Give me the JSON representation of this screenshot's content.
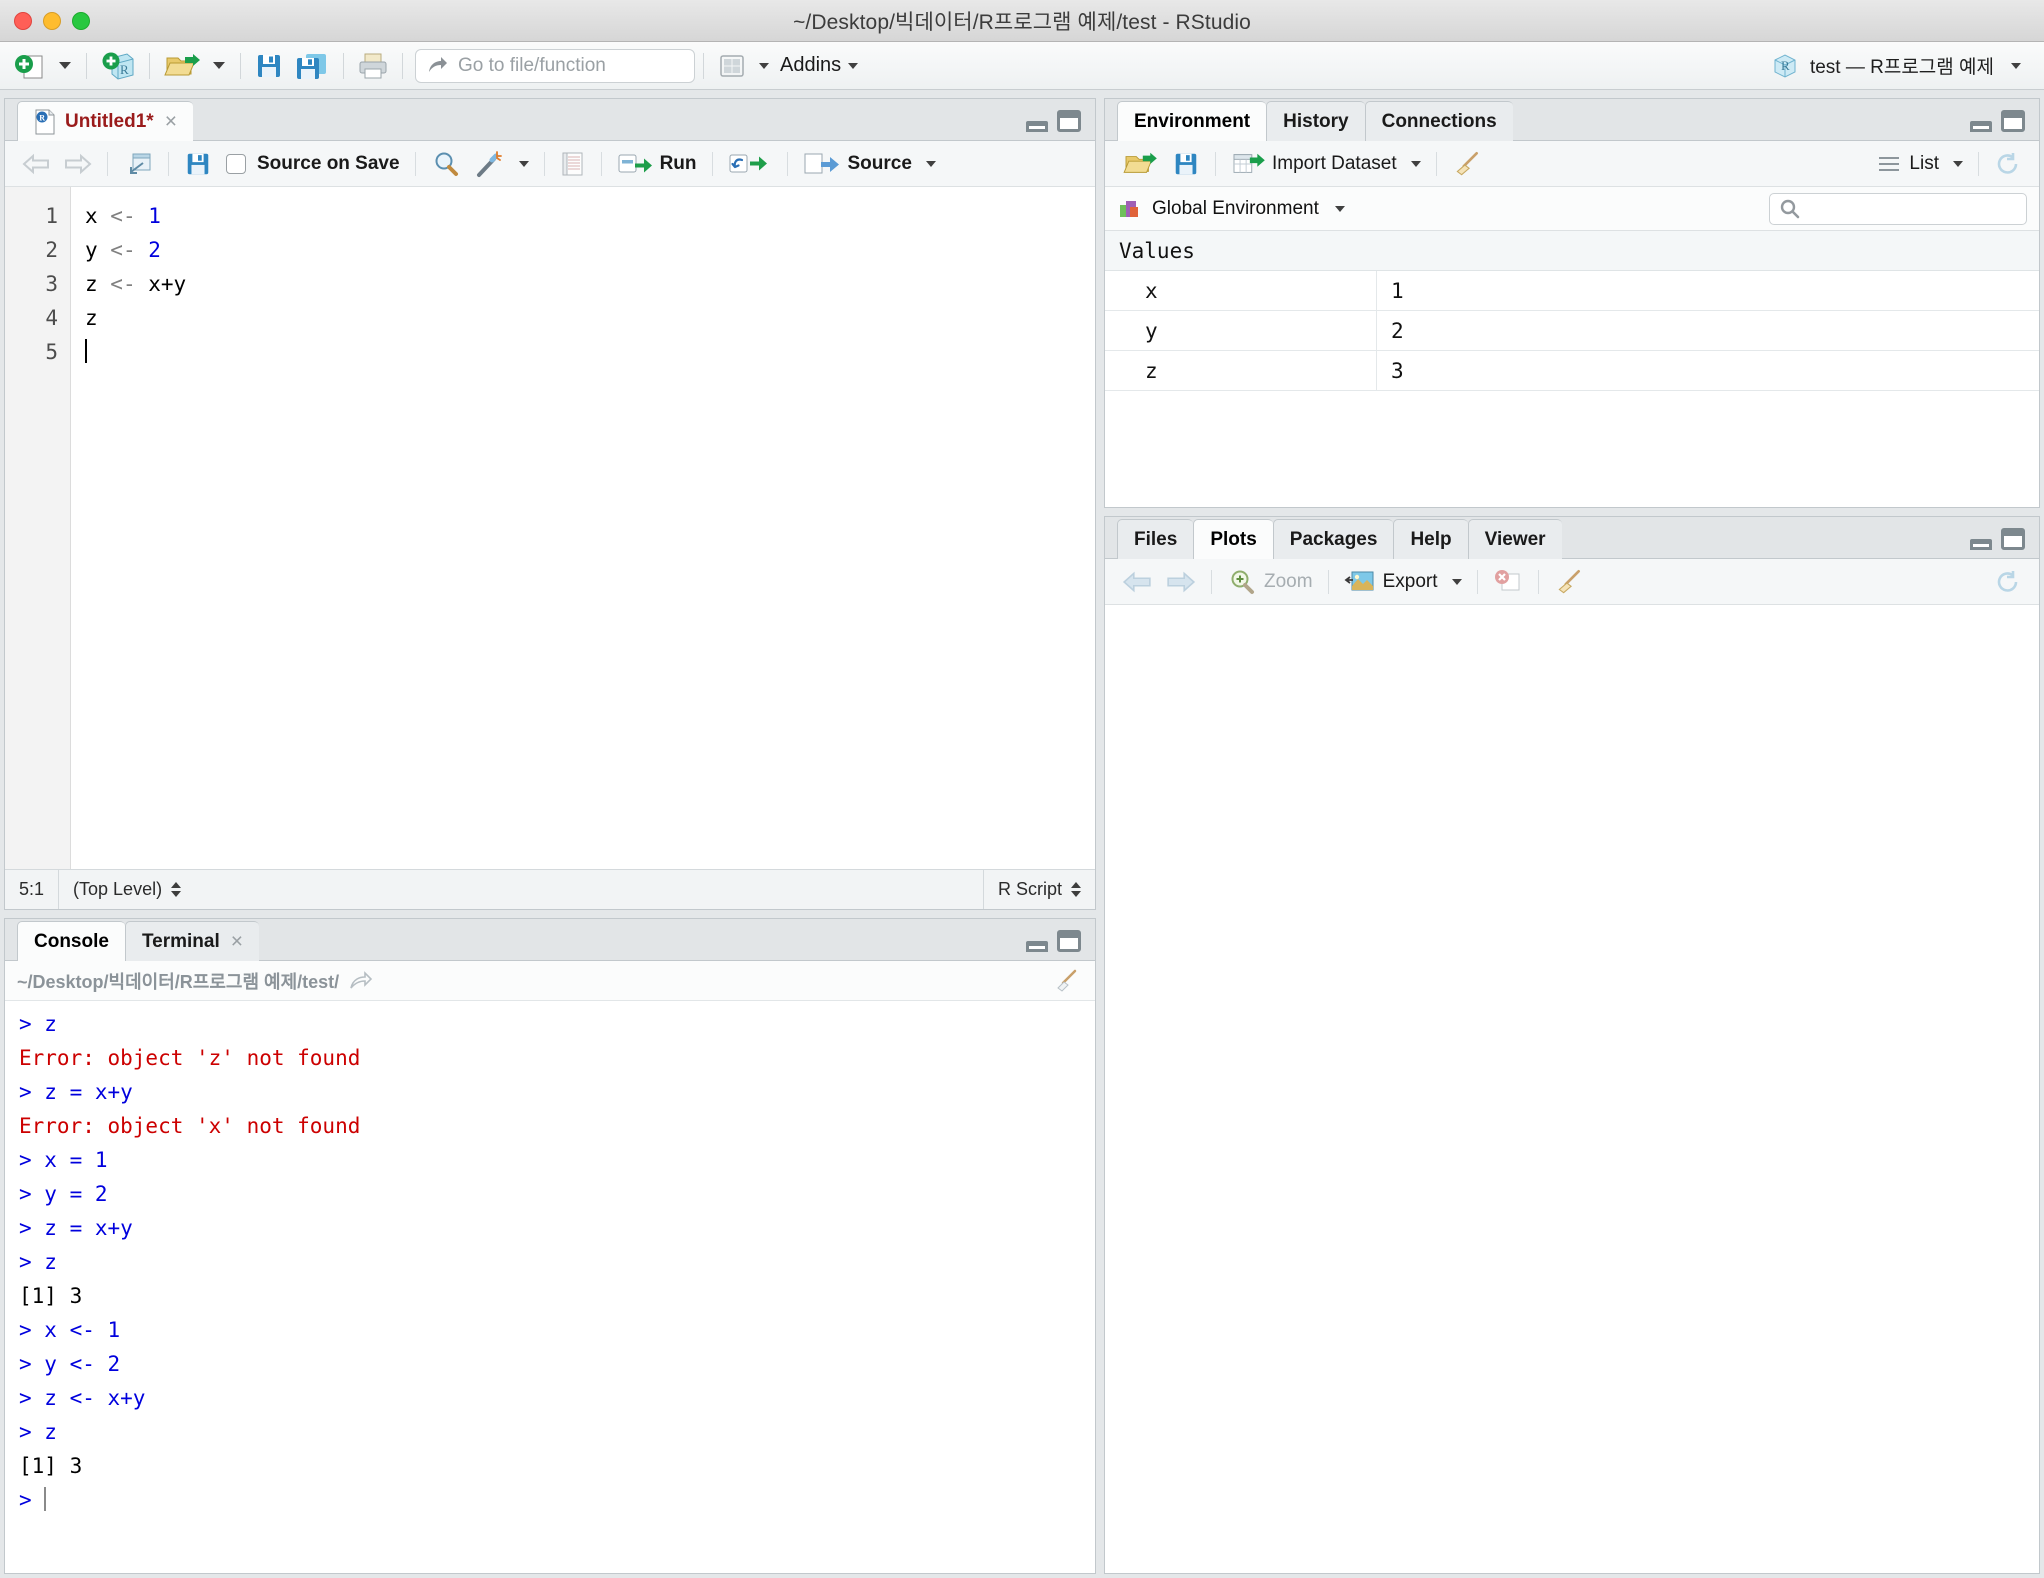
{
  "window": {
    "title": "~/Desktop/빅데이터/R프로그램 예제/test - RStudio",
    "traffic_lights": [
      "close-red",
      "minimize-yellow",
      "zoom-green"
    ]
  },
  "main_toolbar": {
    "new_file_label": "new-file",
    "new_project_label": "new-project",
    "open_file_label": "open-file",
    "save_label": "save",
    "save_all_label": "save-all",
    "print_label": "print",
    "goto_placeholder": "Go to file/function",
    "panes_label": "workspace-panes",
    "addins_label": "Addins",
    "project_label": "test — R프로그램 예제"
  },
  "source_pane": {
    "tabs": [
      {
        "label": "Untitled1*",
        "active": true,
        "modified": true,
        "closable": true
      }
    ],
    "toolbar": {
      "back_label": "back",
      "forward_label": "forward",
      "popout_label": "show-in-new-window",
      "save_label": "save",
      "source_on_save_label": "Source on Save",
      "source_on_save_checked": false,
      "find_label": "find-replace",
      "magic_label": "code-tools",
      "compile_label": "compile-report",
      "run_label": "Run",
      "rerun_label": "re-run",
      "source_label": "Source"
    },
    "code_lines": [
      {
        "n": "1",
        "tokens": [
          {
            "t": "x ",
            "c": "plain"
          },
          {
            "t": "<- ",
            "c": "op"
          },
          {
            "t": "1",
            "c": "num"
          }
        ]
      },
      {
        "n": "2",
        "tokens": [
          {
            "t": "y ",
            "c": "plain"
          },
          {
            "t": "<- ",
            "c": "op"
          },
          {
            "t": "2",
            "c": "num"
          }
        ]
      },
      {
        "n": "3",
        "tokens": [
          {
            "t": "z ",
            "c": "plain"
          },
          {
            "t": "<- ",
            "c": "op"
          },
          {
            "t": "x+y",
            "c": "plain"
          }
        ]
      },
      {
        "n": "4",
        "tokens": [
          {
            "t": "z",
            "c": "plain"
          }
        ]
      },
      {
        "n": "5",
        "tokens": [
          {
            "t": "",
            "c": "cursor"
          }
        ]
      }
    ],
    "status": {
      "cursor_position": "5:1",
      "scope": "(Top Level)",
      "file_type": "R Script"
    }
  },
  "console_pane": {
    "tabs": [
      {
        "label": "Console",
        "active": true,
        "closable": false
      },
      {
        "label": "Terminal",
        "active": false,
        "closable": true
      }
    ],
    "working_directory": "~/Desktop/빅데이터/R프로그램 예제/test/",
    "lines": [
      {
        "text": "> z",
        "kind": "input"
      },
      {
        "text": "Error: object 'z' not found",
        "kind": "error"
      },
      {
        "text": "> z = x+y",
        "kind": "input"
      },
      {
        "text": "Error: object 'x' not found",
        "kind": "error"
      },
      {
        "text": "> x = 1",
        "kind": "input"
      },
      {
        "text": "> y = 2",
        "kind": "input"
      },
      {
        "text": "> z = x+y",
        "kind": "input"
      },
      {
        "text": "> z",
        "kind": "input"
      },
      {
        "text": "[1] 3",
        "kind": "output"
      },
      {
        "text": "> x <- 1",
        "kind": "input"
      },
      {
        "text": "> y <- 2",
        "kind": "input"
      },
      {
        "text": "> z <- x+y",
        "kind": "input"
      },
      {
        "text": "> z",
        "kind": "input"
      },
      {
        "text": "[1] 3",
        "kind": "output"
      },
      {
        "text": "> ",
        "kind": "prompt"
      }
    ]
  },
  "environment_pane": {
    "tabs": [
      {
        "label": "Environment",
        "active": true
      },
      {
        "label": "History",
        "active": false
      },
      {
        "label": "Connections",
        "active": false
      }
    ],
    "toolbar": {
      "load_label": "load-workspace",
      "save_label": "save-workspace",
      "import_dataset_label": "Import Dataset",
      "clear_label": "clear-objects",
      "view_mode_label": "List",
      "refresh_label": "refresh"
    },
    "scope_label": "Global Environment",
    "search_placeholder": "",
    "section_title": "Values",
    "values": [
      {
        "name": "x",
        "value": "1"
      },
      {
        "name": "y",
        "value": "2"
      },
      {
        "name": "z",
        "value": "3"
      }
    ]
  },
  "plots_pane": {
    "tabs": [
      {
        "label": "Files",
        "active": false
      },
      {
        "label": "Plots",
        "active": true
      },
      {
        "label": "Packages",
        "active": false
      },
      {
        "label": "Help",
        "active": false
      },
      {
        "label": "Viewer",
        "active": false
      }
    ],
    "toolbar": {
      "back_label": "previous-plot",
      "forward_label": "next-plot",
      "zoom_label": "Zoom",
      "export_label": "Export",
      "remove_label": "remove-plot",
      "clear_label": "clear-all-plots",
      "refresh_label": "refresh"
    }
  },
  "colors": {
    "accent_blue": "#0000dd",
    "error_red": "#cc0000",
    "tab_modified_red": "#9a1b1b",
    "panel_bg": "#ffffff",
    "chrome_bg": "#e4e7e9"
  }
}
